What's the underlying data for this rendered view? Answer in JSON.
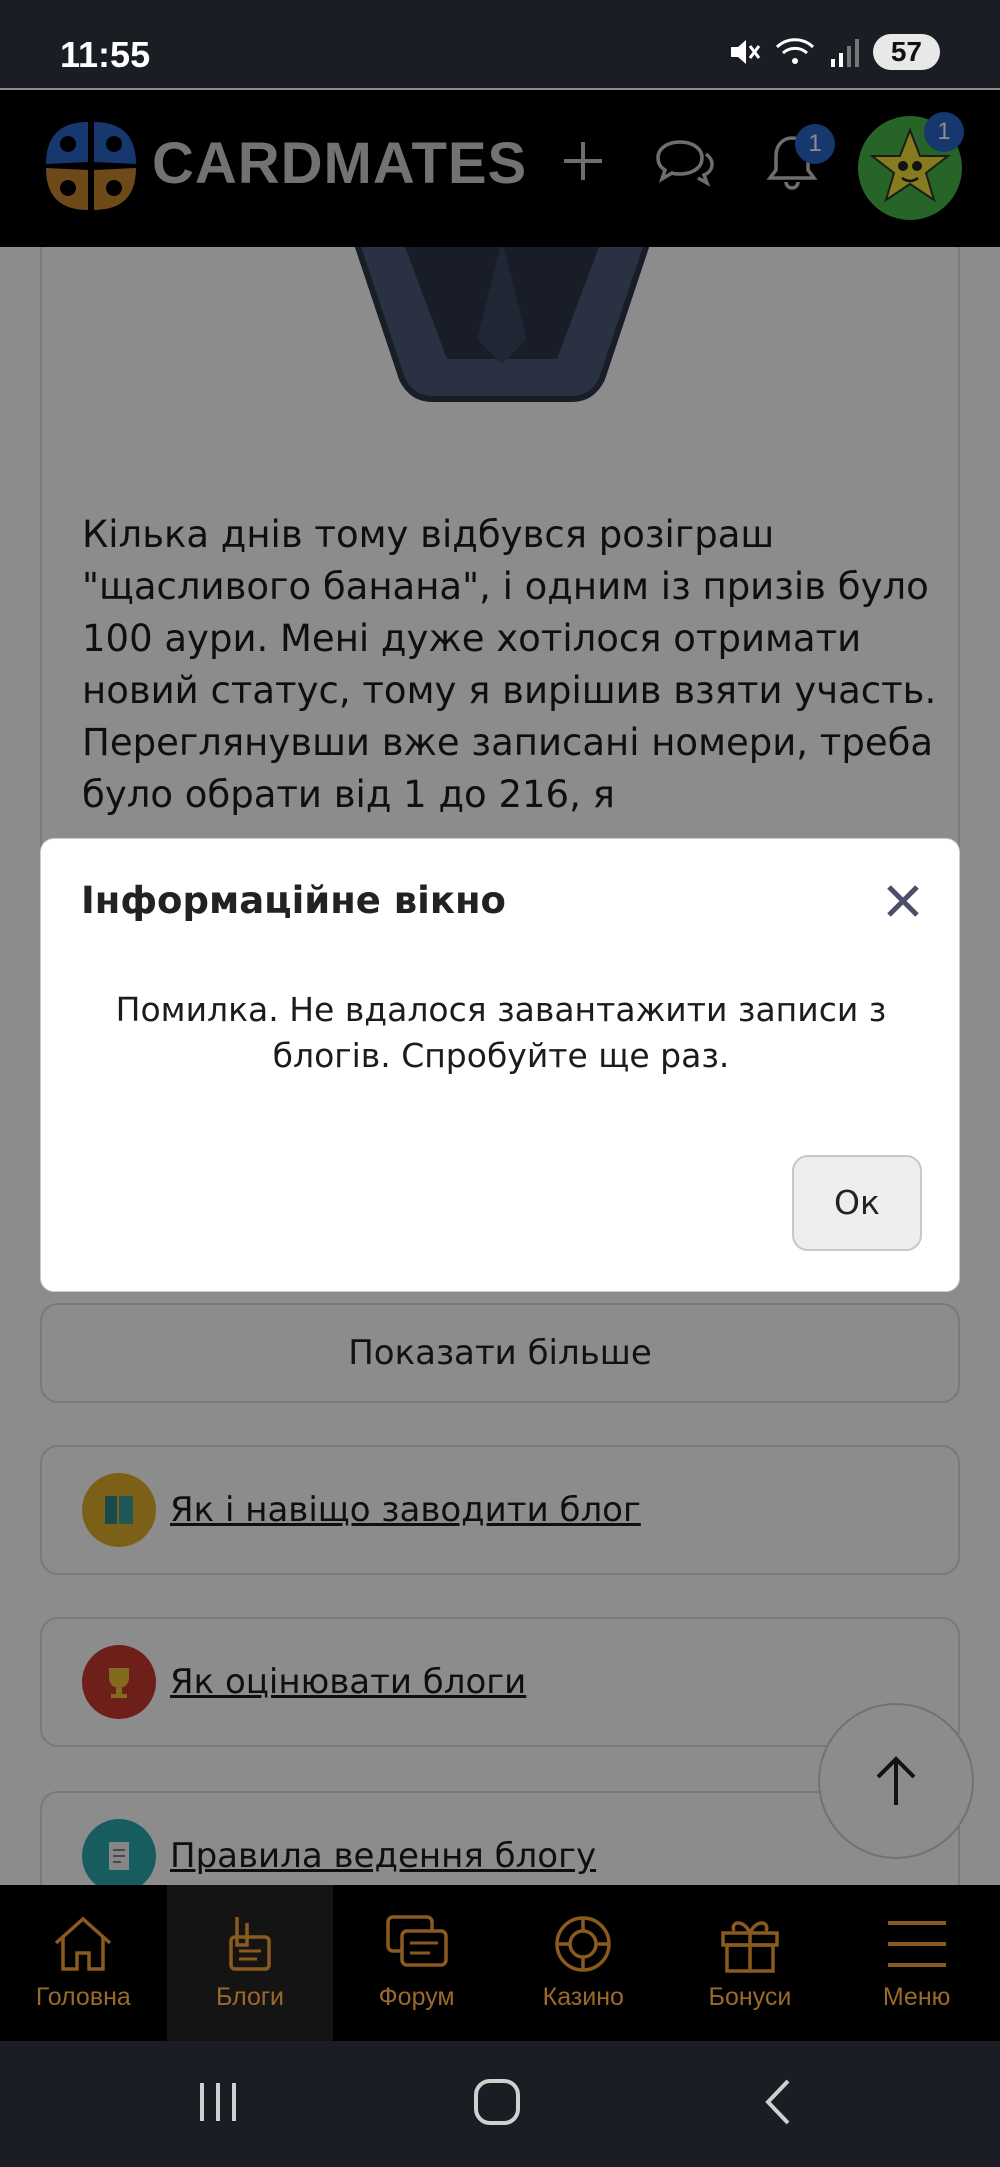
{
  "status_bar": {
    "time": "11:55",
    "battery": "57"
  },
  "header": {
    "brand": "CARDMATES",
    "notifications_badge": "1",
    "avatar_badge": "1",
    "icons": [
      "add-icon",
      "chat-icon",
      "bell-icon"
    ]
  },
  "post": {
    "text": "Кілька днів тому відбувся розіграш \"щасливого банана\", і одним із призів було 100 аури. Мені дуже хотілося отримати новий статус, тому я вирішив взяти участь. Переглянувши вже записані номери,  треба було обрати від 1 до 216, я"
  },
  "show_more": "Показати більше",
  "links": [
    {
      "label": "Як і навіщо заводити блог",
      "icon": "book-icon"
    },
    {
      "label": "Як оцінювати блоги",
      "icon": "trophy-icon"
    },
    {
      "label": "Правила ведення блогу",
      "icon": "document-icon"
    }
  ],
  "modal": {
    "title": "Інформаційне вікно",
    "message": "Помилка. Не вдалося завантажити записи з блогів. Спробуйте ще раз.",
    "ok_label": "Ок"
  },
  "bottom_nav": [
    {
      "label": "Головна",
      "icon": "home-icon"
    },
    {
      "label": "Блоги",
      "icon": "blog-icon",
      "active": true
    },
    {
      "label": "Форум",
      "icon": "forum-icon"
    },
    {
      "label": "Казино",
      "icon": "casino-icon"
    },
    {
      "label": "Бонуси",
      "icon": "gift-icon"
    },
    {
      "label": "Меню",
      "icon": "menu-icon"
    }
  ],
  "colors": {
    "accent_gold": "#c8872e",
    "accent_blue": "#2a67c9",
    "overlay": "rgba(0,0,0,0.45)"
  }
}
